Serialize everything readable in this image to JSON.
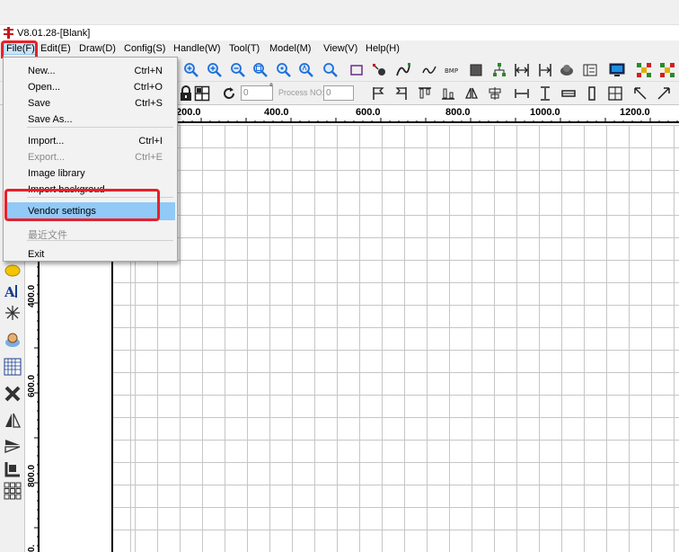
{
  "window": {
    "title": "V8.01.28-[Blank]"
  },
  "menubar": [
    {
      "label": "File(F)",
      "name": "menu-file",
      "active": true
    },
    {
      "label": "Edit(E)",
      "name": "menu-edit"
    },
    {
      "label": "Draw(D)",
      "name": "menu-draw"
    },
    {
      "label": "Config(S)",
      "name": "menu-config"
    },
    {
      "label": "Handle(W)",
      "name": "menu-handle"
    },
    {
      "label": "Tool(T)",
      "name": "menu-tool"
    },
    {
      "label": "Model(M)",
      "name": "menu-model"
    },
    {
      "label": "View(V)",
      "name": "menu-view"
    },
    {
      "label": "Help(H)",
      "name": "menu-help"
    }
  ],
  "file_menu": {
    "items": [
      {
        "label": "New...",
        "shortcut": "Ctrl+N"
      },
      {
        "label": "Open...",
        "shortcut": "Ctrl+O"
      },
      {
        "label": "Save",
        "shortcut": "Ctrl+S"
      },
      {
        "label": "Save As...",
        "shortcut": ""
      },
      {
        "label": "Import...",
        "shortcut": "Ctrl+I"
      },
      {
        "label": "Export...",
        "shortcut": "Ctrl+E",
        "disabled": true
      },
      {
        "label": "Image library",
        "shortcut": ""
      },
      {
        "label": "Import backgroud",
        "shortcut": ""
      },
      {
        "label": "Vendor settings",
        "shortcut": "",
        "selected": true
      },
      {
        "label": "最近文件",
        "shortcut": "",
        "disabled": true
      },
      {
        "label": "Exit",
        "shortcut": ""
      }
    ]
  },
  "toolbar2": {
    "angle_value": "0",
    "angle_unit": "°",
    "process_no_label": "Process NO:",
    "process_no_value": "0"
  },
  "ruler_h": [
    "200.0",
    "400.0",
    "600.0",
    "800.0",
    "1000.0",
    "1200.0"
  ],
  "ruler_v": [
    "400.0",
    "600.0",
    "800.0",
    "0."
  ],
  "colors": {
    "highlight": "#e8202a",
    "selection": "#91c9f7",
    "accent_icon": "#1e6fd9"
  },
  "icons": {
    "toolbar1": [
      "zoom-in-icon",
      "zoom-in-icon",
      "zoom-out-icon",
      "zoom-window-icon",
      "zoom-fit-icon",
      "zoom-page-icon",
      "zoom-select-icon",
      "rectangle-icon",
      "node-edit-icon",
      "curve-edit-icon",
      "polyline-icon",
      "bitmap-icon",
      "fill-square-icon",
      "tree-icon",
      "width-icon",
      "height-icon",
      "cloud-icon",
      "layer-icon",
      "monitor-icon",
      "multi-node-icon",
      "multi-node-icon"
    ],
    "toolbar2": [
      "lock-icon",
      "grid-icon",
      "rotate-icon",
      "flag-left-icon",
      "flag-right-icon",
      "align-top-icon",
      "align-bottom-icon",
      "mirror-icon",
      "distribute-icon",
      "h-space-icon",
      "v-space-icon",
      "h-equal-icon",
      "v-equal-icon",
      "grid-align-icon",
      "arrow-ul-icon",
      "arrow-ur-icon"
    ],
    "left": [
      "ellipse-icon",
      "text-icon",
      "star-icon",
      "camera-icon",
      "array-grid-icon",
      "delete-x-icon",
      "mirror-h-icon",
      "mirror-v-icon",
      "corner-icon",
      "matrix-icon"
    ]
  }
}
